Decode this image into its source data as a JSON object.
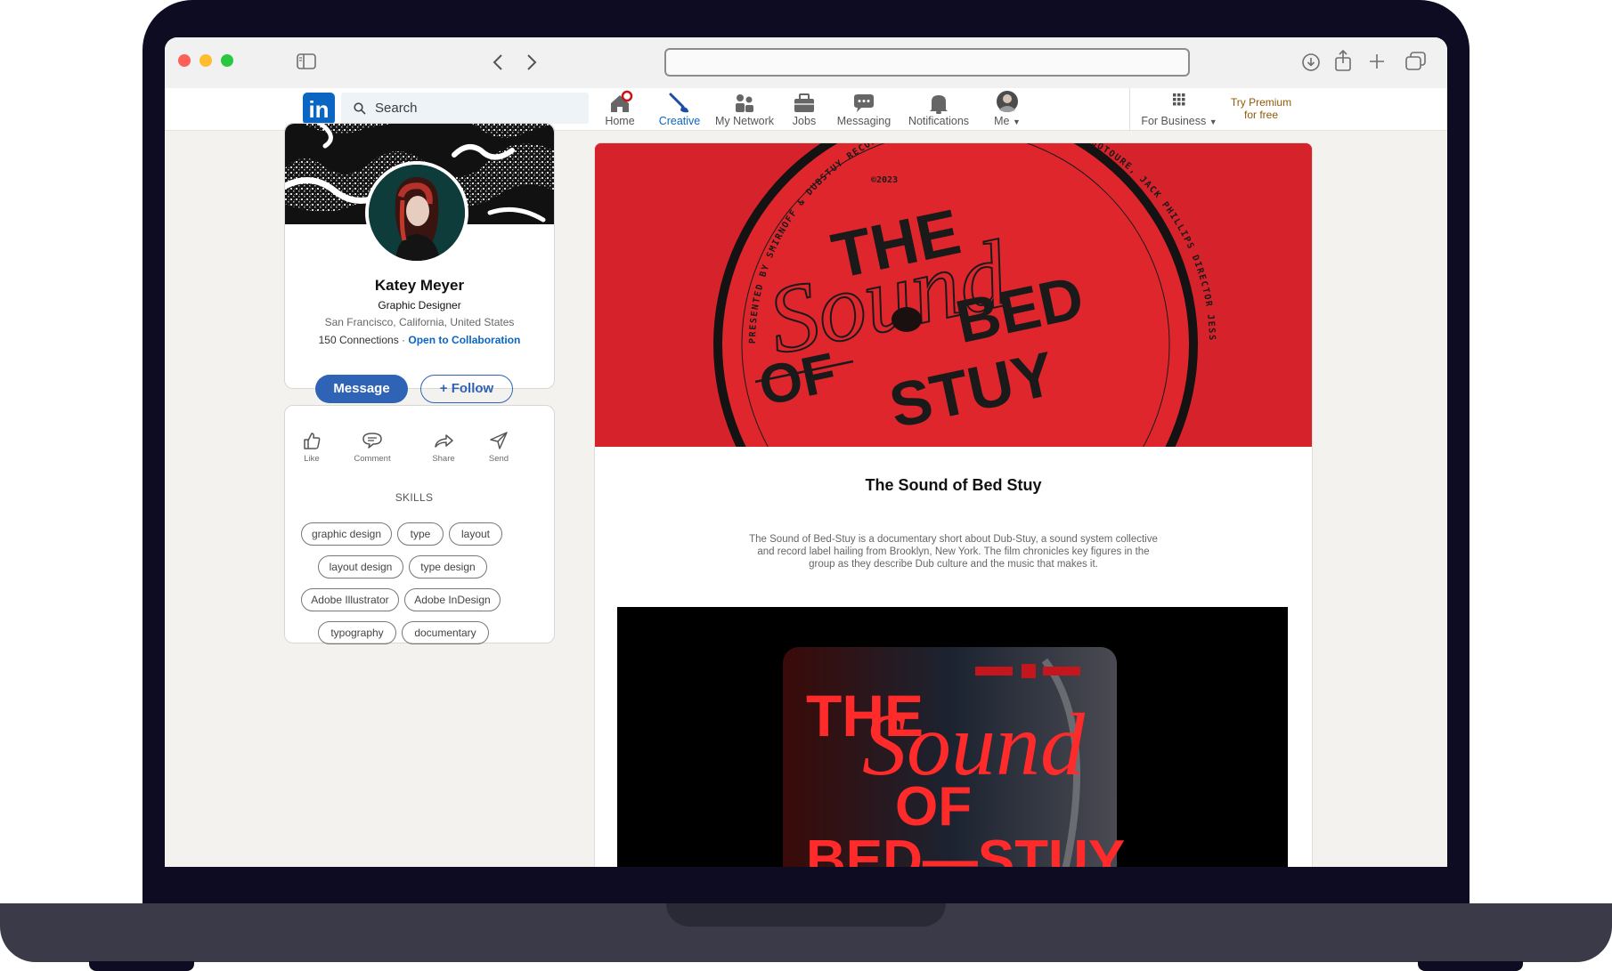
{
  "nav": {
    "search_placeholder": "Search",
    "items": [
      {
        "label": "Home",
        "icon": "home-icon"
      },
      {
        "label": "Creative",
        "icon": "brush-icon"
      },
      {
        "label": "My Network",
        "icon": "network-icon"
      },
      {
        "label": "Jobs",
        "icon": "briefcase-icon"
      },
      {
        "label": "Messaging",
        "icon": "chat-icon"
      },
      {
        "label": "Notifications",
        "icon": "bell-icon"
      },
      {
        "label": "Me",
        "icon": "avatar"
      }
    ],
    "for_business": "For Business",
    "premium": "Try Premium for free",
    "logo_text": "in",
    "accent": "#0a66c2"
  },
  "profile": {
    "name": "Katey Meyer",
    "title": "Graphic Designer",
    "location": "San Francisco, California, United States",
    "connections": "150 Connections",
    "collab": "Open to Collaboration",
    "message_label": "Message",
    "follow_label": "+ Follow"
  },
  "actions": [
    {
      "label": "Like",
      "icon": "thumbs-up-icon"
    },
    {
      "label": "Comment",
      "icon": "comment-icon"
    },
    {
      "label": "Share",
      "icon": "share-icon"
    },
    {
      "label": "Send",
      "icon": "send-icon"
    }
  ],
  "skills": {
    "heading": "SKILLS",
    "items": [
      "graphic design",
      "type",
      "layout",
      "layout design",
      "type design",
      "Adobe Illustrator",
      "Adobe InDesign",
      "typography",
      "documentary"
    ]
  },
  "post": {
    "title": "The Sound of Bed Stuy",
    "description": "The Sound of Bed-Stuy is a documentary short about Dub-Stuy, a sound system collective and record label hailing from Brooklyn, New York. The film chronicles key figures in the group as they describe Dub culture and the music that makes it.",
    "hero": {
      "line1": "THE",
      "script": "Sound",
      "line2": "OF",
      "line3": "BED",
      "line4": "STUY",
      "year": "©2023",
      "ring": "PRESENTED BY SMIRNOFF & DUBSTUY RECORDS  DUBSTUY CREW  QUOC PHAM, JONNY GOTOURE, JACK PHILLIPS  DIRECTOR JESS COLQUHOUN  PRODUCTION COMPANY STEPT STUDIOS"
    },
    "video": {
      "line1": "THE",
      "script": "Sound",
      "line2": "OF",
      "line3": "BED—STUY"
    },
    "colors": {
      "red": "#d9232b",
      "video_red": "#ff2a2a"
    }
  }
}
